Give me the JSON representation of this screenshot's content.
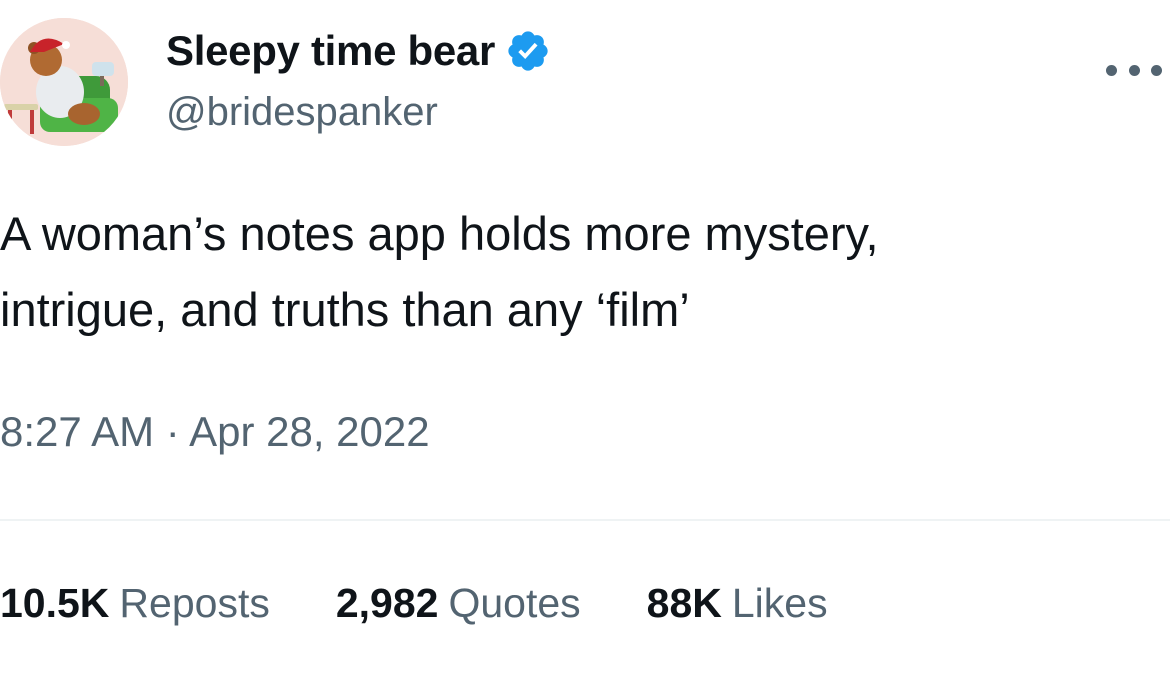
{
  "author": {
    "display_name": "Sleepy time bear",
    "handle": "@bridespanker",
    "verified": true,
    "verified_color": "#1d9bf0",
    "avatar_icon": "sleeping-bear-avatar"
  },
  "menu_icon": "more-options-icon",
  "tweet": {
    "text_lines": [
      "A woman’s notes app holds more mystery,",
      "intrigue, and truths than any ‘film’"
    ],
    "timestamp": "8:27 AM · Apr 28, 2022"
  },
  "stats": [
    {
      "count": "10.5K",
      "label": "Reposts"
    },
    {
      "count": "2,982",
      "label": "Quotes"
    },
    {
      "count": "88K",
      "label": "Likes"
    }
  ],
  "colors": {
    "text_primary": "#0f1419",
    "text_secondary": "#536471",
    "divider": "#eff3f4"
  }
}
